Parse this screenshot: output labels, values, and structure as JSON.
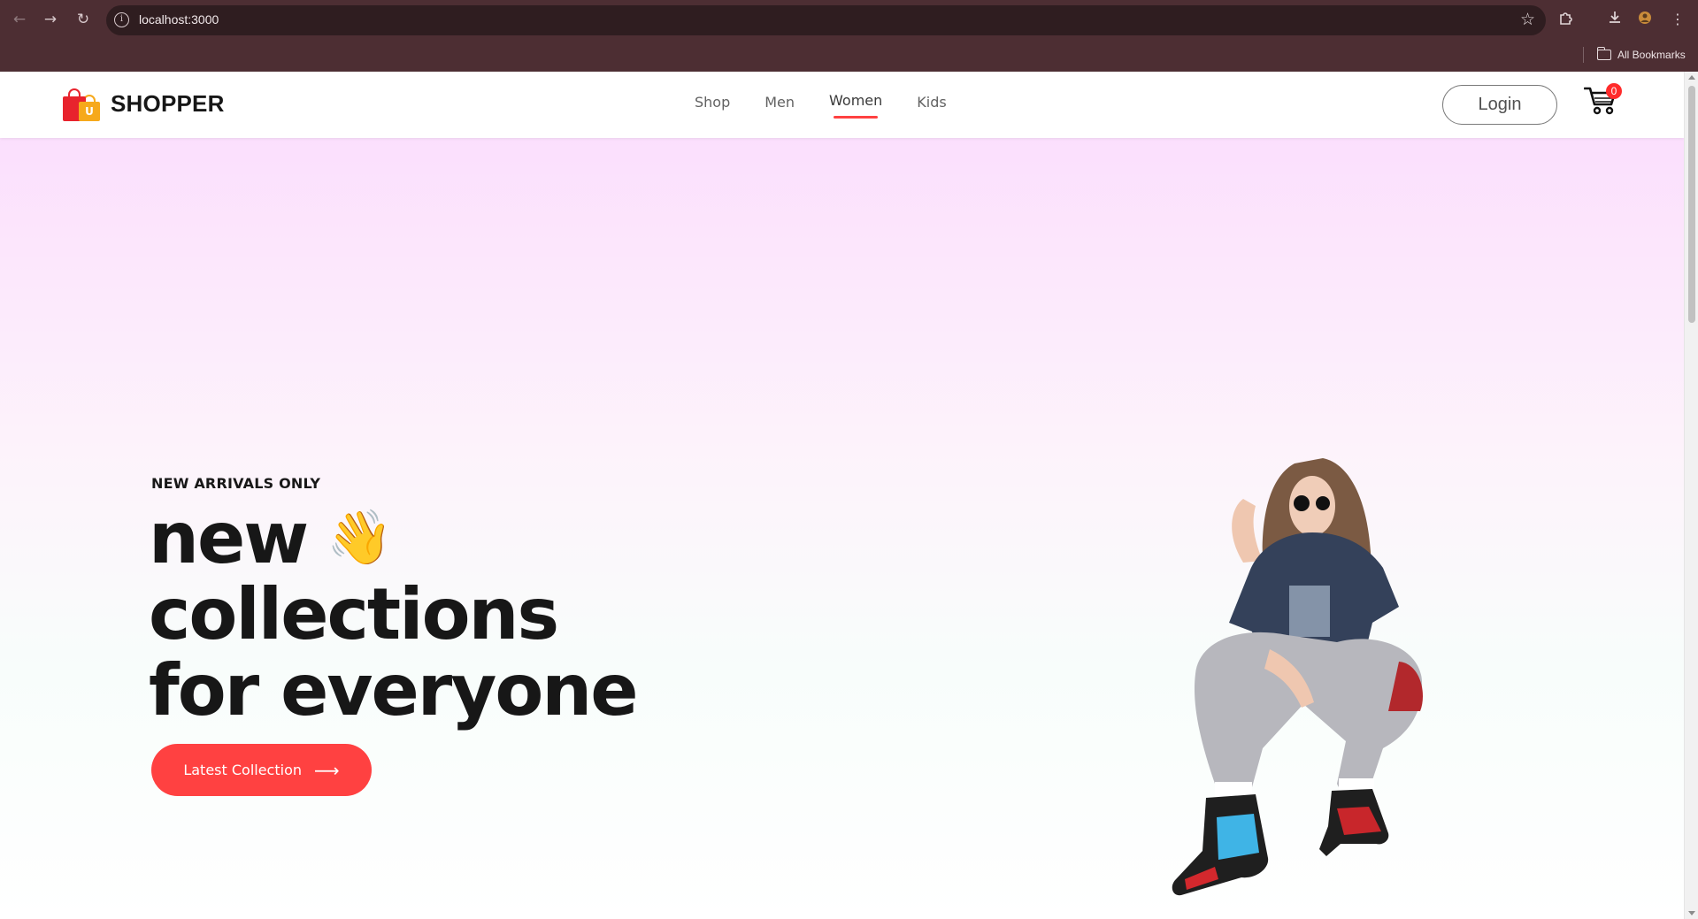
{
  "browser": {
    "url": "localhost:3000",
    "bookmarks_label": "All Bookmarks"
  },
  "site": {
    "brand": "SHOPPER",
    "logo_letter": "U",
    "menu": [
      {
        "label": "Shop",
        "active": false
      },
      {
        "label": "Men",
        "active": false
      },
      {
        "label": "Women",
        "active": true
      },
      {
        "label": "Kids",
        "active": false
      }
    ],
    "login_label": "Login",
    "cart_count": "0",
    "accent_color": "#ff4141"
  },
  "hero": {
    "eyebrow": "NEW ARRIVALS ONLY",
    "headline_lines": [
      "new",
      "collections",
      "for everyone"
    ],
    "wave_emoji": "👋",
    "cta_label": "Latest Collection",
    "cta_arrow": "⟶"
  },
  "icons": {
    "back": "back-arrow-icon",
    "forward": "forward-arrow-icon",
    "reload": "reload-icon",
    "site_info": "info-icon",
    "bookmark_star": "star-icon",
    "extensions": "puzzle-icon",
    "download": "download-icon",
    "profile": "profile-icon",
    "menu": "kebab-menu-icon",
    "cart": "cart-icon",
    "folder": "folder-icon"
  }
}
